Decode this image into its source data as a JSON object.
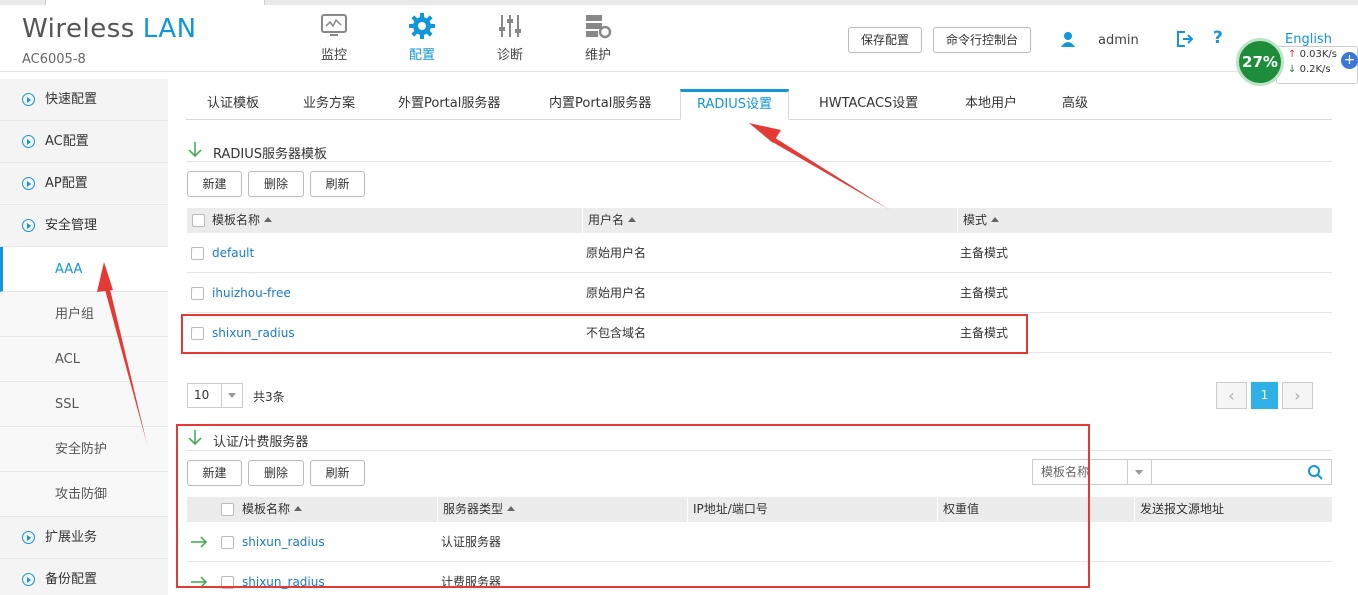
{
  "brand": {
    "title_a": "Wireless",
    "title_b": "LAN",
    "model": "AC6005-8"
  },
  "nav": [
    {
      "label": "监控",
      "icon": "monitor-icon"
    },
    {
      "label": "配置",
      "icon": "gear-icon",
      "active": true
    },
    {
      "label": "诊断",
      "icon": "sliders-icon"
    },
    {
      "label": "维护",
      "icon": "server-maintain-icon"
    }
  ],
  "header": {
    "save_label": "保存配置",
    "cli_label": "命令行控制台",
    "username": "admin",
    "language": "English"
  },
  "speed": {
    "percent": "27%",
    "up": "0.03K/s",
    "down": "0.2K/s"
  },
  "sidebar": {
    "items": [
      {
        "label": "快速配置"
      },
      {
        "label": "AC配置"
      },
      {
        "label": "AP配置"
      },
      {
        "label": "安全管理"
      }
    ],
    "sub": [
      {
        "label": "AAA",
        "active": true
      },
      {
        "label": "用户组"
      },
      {
        "label": "ACL"
      },
      {
        "label": "SSL"
      },
      {
        "label": "安全防护"
      },
      {
        "label": "攻击防御"
      }
    ],
    "items_after": [
      {
        "label": "扩展业务"
      },
      {
        "label": "备份配置"
      }
    ]
  },
  "tabs": [
    {
      "label": "认证模板"
    },
    {
      "label": "业务方案"
    },
    {
      "label": "外置Portal服务器"
    },
    {
      "label": "内置Portal服务器"
    },
    {
      "label": "RADIUS设置",
      "active": true
    },
    {
      "label": "HWTACACS设置"
    },
    {
      "label": "本地用户"
    },
    {
      "label": "高级"
    }
  ],
  "radius_templates": {
    "title": "RADIUS服务器模板",
    "buttons": {
      "new": "新建",
      "delete": "删除",
      "refresh": "刷新"
    },
    "columns": [
      "模板名称",
      "用户名",
      "模式"
    ],
    "rows": [
      {
        "name": "default",
        "username": "原始用户名",
        "mode": "主备模式"
      },
      {
        "name": "ihuizhou-free",
        "username": "原始用户名",
        "mode": "主备模式"
      },
      {
        "name": "shixun_radius",
        "username": "不包含域名",
        "mode": "主备模式"
      }
    ],
    "page_size": "10",
    "total": "共3条",
    "current_page": "1",
    "prev": "‹",
    "next": "›"
  },
  "auth_servers": {
    "title": "认证/计费服务器",
    "buttons": {
      "new": "新建",
      "delete": "删除",
      "refresh": "刷新"
    },
    "search_field": "模板名称",
    "search_value": "",
    "columns": [
      "模板名称",
      "服务器类型",
      "IP地址/端口号",
      "权重值",
      "发送报文源地址"
    ],
    "rows": [
      {
        "name": "shixun_radius",
        "type": "认证服务器"
      },
      {
        "name": "shixun_radius",
        "type": "计费服务器"
      }
    ]
  },
  "colors": {
    "accent": "#1296db",
    "annotation": "#e53935",
    "link": "#1a7bc5"
  }
}
